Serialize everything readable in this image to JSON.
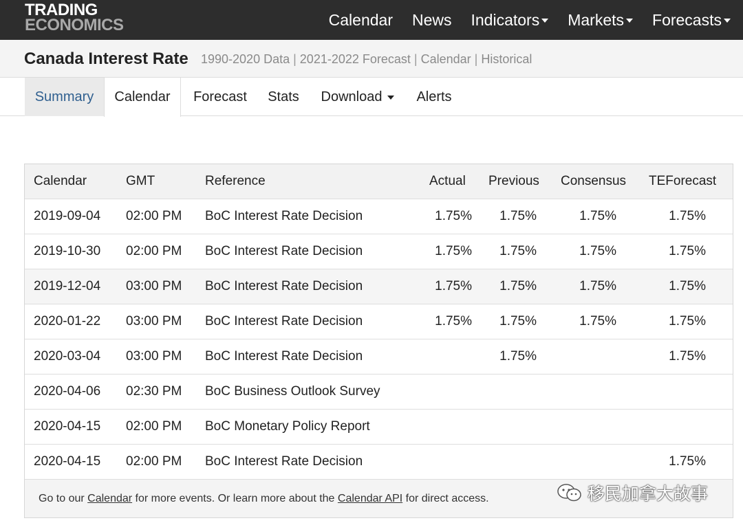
{
  "brand": {
    "line1": "TRADING",
    "line2": "ECONOMICS"
  },
  "nav": [
    {
      "label": "Calendar",
      "dropdown": false
    },
    {
      "label": "News",
      "dropdown": false
    },
    {
      "label": "Indicators",
      "dropdown": true
    },
    {
      "label": "Markets",
      "dropdown": true
    },
    {
      "label": "Forecasts",
      "dropdown": true
    }
  ],
  "header": {
    "title": "Canada Interest Rate",
    "links": [
      "1990-2020 Data",
      "2021-2022 Forecast",
      "Calendar",
      "Historical"
    ],
    "separator": "|"
  },
  "tabs": {
    "summary": "Summary",
    "calendar": "Calendar",
    "forecast": "Forecast",
    "stats": "Stats",
    "download": "Download",
    "alerts": "Alerts",
    "active": "Calendar"
  },
  "table": {
    "columns": {
      "calendar": "Calendar",
      "gmt": "GMT",
      "reference": "Reference",
      "actual": "Actual",
      "previous": "Previous",
      "consensus": "Consensus",
      "teforecast": "TEForecast"
    },
    "rows": [
      {
        "date": "2019-09-04",
        "gmt": "02:00 PM",
        "reference": "BoC Interest Rate Decision",
        "actual": "1.75%",
        "previous": "1.75%",
        "consensus": "1.75%",
        "teforecast": "1.75%"
      },
      {
        "date": "2019-10-30",
        "gmt": "02:00 PM",
        "reference": "BoC Interest Rate Decision",
        "actual": "1.75%",
        "previous": "1.75%",
        "consensus": "1.75%",
        "teforecast": "1.75%"
      },
      {
        "date": "2019-12-04",
        "gmt": "03:00 PM",
        "reference": "BoC Interest Rate Decision",
        "actual": "1.75%",
        "previous": "1.75%",
        "consensus": "1.75%",
        "teforecast": "1.75%"
      },
      {
        "date": "2020-01-22",
        "gmt": "03:00 PM",
        "reference": "BoC Interest Rate Decision",
        "actual": "1.75%",
        "previous": "1.75%",
        "consensus": "1.75%",
        "teforecast": "1.75%"
      },
      {
        "date": "2020-03-04",
        "gmt": "03:00 PM",
        "reference": "BoC Interest Rate Decision",
        "actual": "",
        "previous": "1.75%",
        "consensus": "",
        "teforecast": "1.75%"
      },
      {
        "date": "2020-04-06",
        "gmt": "02:30 PM",
        "reference": "BoC Business Outlook Survey",
        "actual": "",
        "previous": "",
        "consensus": "",
        "teforecast": ""
      },
      {
        "date": "2020-04-15",
        "gmt": "02:00 PM",
        "reference": "BoC Monetary Policy Report",
        "actual": "",
        "previous": "",
        "consensus": "",
        "teforecast": ""
      },
      {
        "date": "2020-04-15",
        "gmt": "02:00 PM",
        "reference": "BoC Interest Rate Decision",
        "actual": "",
        "previous": "",
        "consensus": "",
        "teforecast": "1.75%"
      }
    ]
  },
  "footer": {
    "text1": "Go to our ",
    "link1": "Calendar",
    "text2": " for more events. Or learn more about the ",
    "link2": "Calendar API",
    "text3": " for direct access."
  },
  "watermark": {
    "text": "移民加拿大故事",
    "icon": "wechat-icon"
  },
  "colors": {
    "navbar_bg": "#2d2d2d",
    "titlebar_bg": "#f4f4f4",
    "active_tab_text": "#2f5f8f",
    "header_row_bg": "#f2f2f2"
  }
}
